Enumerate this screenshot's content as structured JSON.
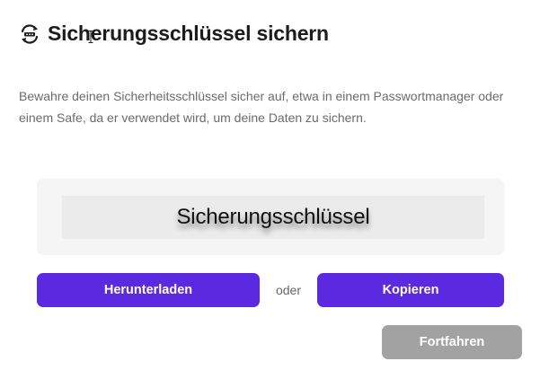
{
  "dialog": {
    "title": "Sicherungsschlüssel sichern",
    "title_icon": "sync-lock-icon",
    "description": "Bewahre deinen Sicherheitsschlüssel sicher auf, etwa in einem Passwortmanager oder einem Safe, da er verwendet wird, um deine Daten zu sichern.",
    "key_value": "Sicherungsschlüssel"
  },
  "actions": {
    "download_label": "Herunterladen",
    "or_label": "oder",
    "copy_label": "Kopieren",
    "continue_label": "Fortfahren"
  },
  "colors": {
    "primary": "#5b29e0",
    "disabled": "#a2a2a2",
    "card_bg": "#f5f5f5"
  }
}
